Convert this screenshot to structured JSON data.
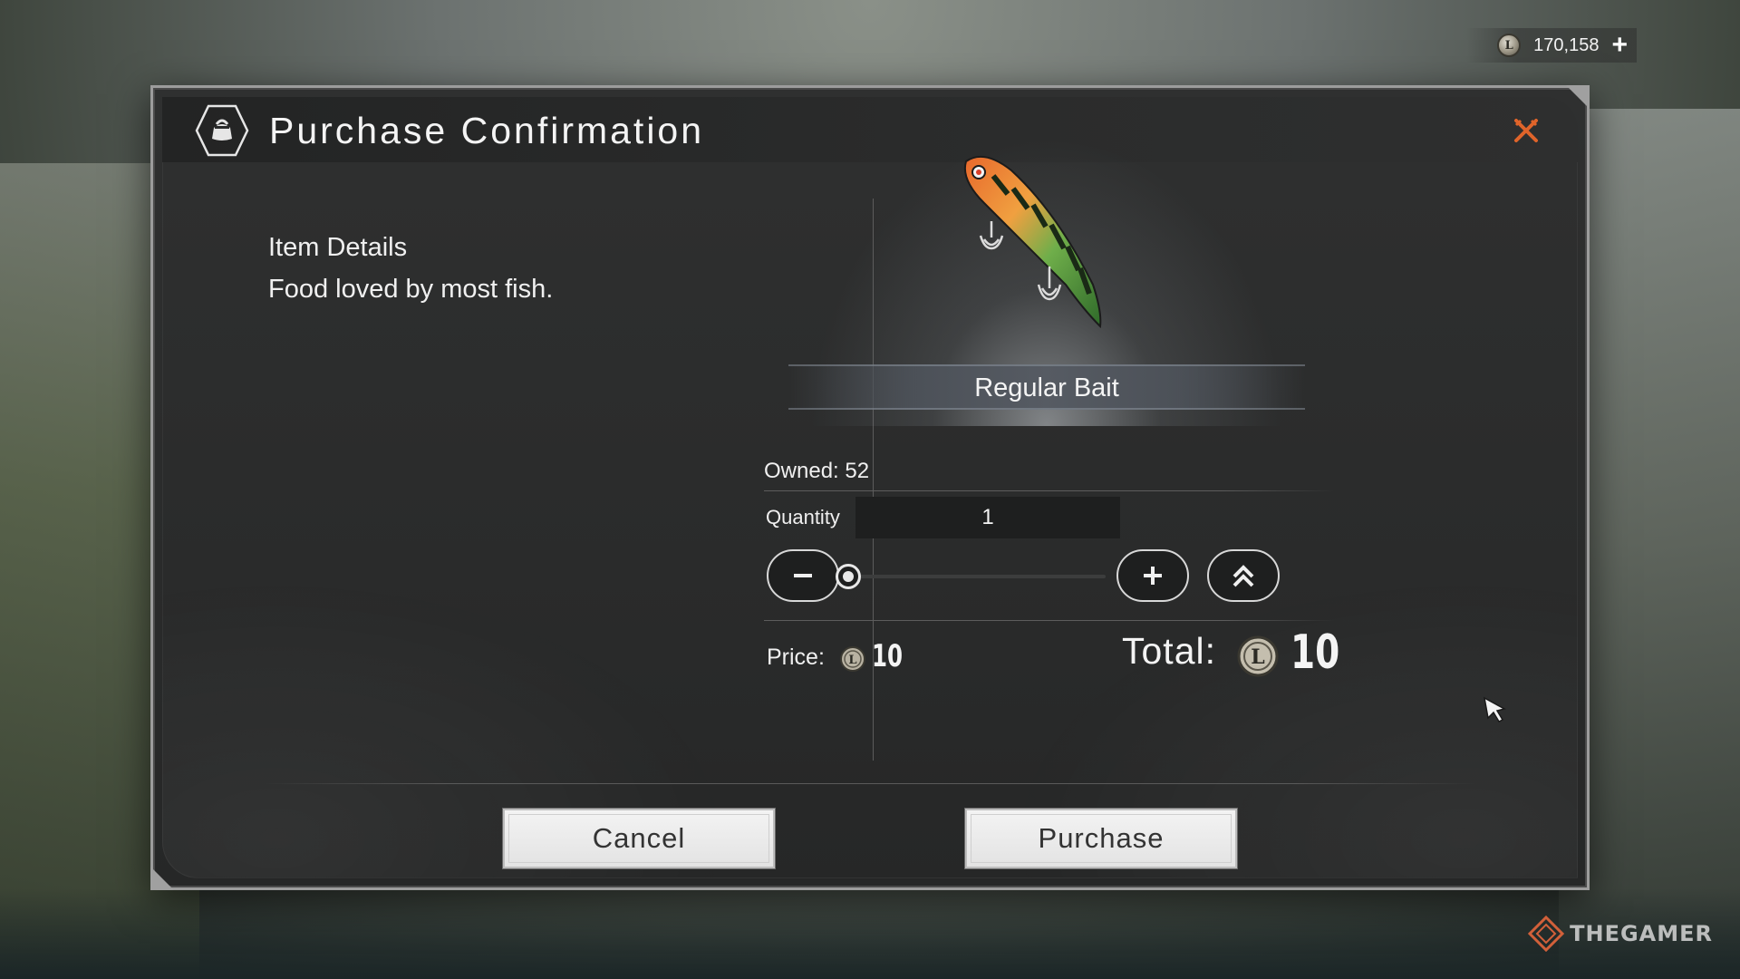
{
  "currency": {
    "icon": "coin-icon",
    "coin_letter": "L",
    "amount": "170,158",
    "add_icon": "plus-icon"
  },
  "dialog": {
    "title": "Purchase Confirmation",
    "header_icon": "bag-icon",
    "close_icon": "close-icon",
    "accent_color": "#e0642a"
  },
  "details": {
    "label": "Item Details",
    "description": "Food loved by most fish."
  },
  "item": {
    "name": "Regular Bait",
    "image_icon": "fishing-lure-icon",
    "owned": "Owned: 52"
  },
  "quantity": {
    "label": "Quantity",
    "value": "1",
    "slider_fraction": 0,
    "minus_icon": "minus-icon",
    "plus_icon": "plus-icon",
    "max_icon": "double-chevron-up-icon"
  },
  "price": {
    "label": "Price:",
    "value": "10"
  },
  "total": {
    "label": "Total:",
    "value": "10"
  },
  "buttons": {
    "cancel": "Cancel",
    "purchase": "Purchase"
  },
  "watermark": {
    "text": "THEGAMER"
  }
}
